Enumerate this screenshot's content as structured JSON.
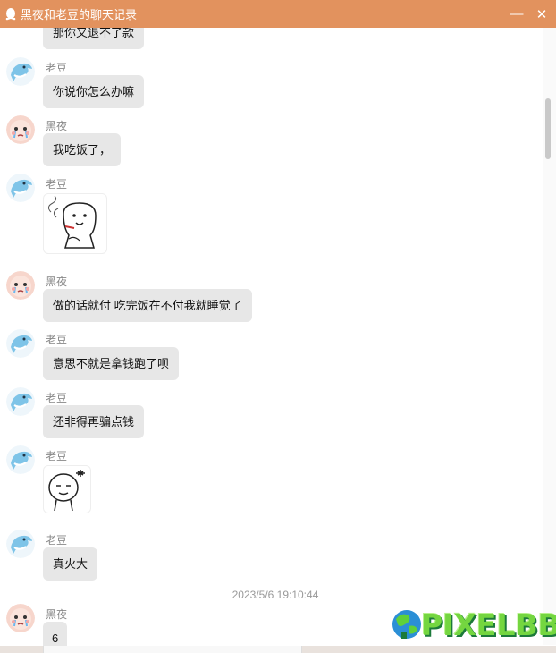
{
  "window": {
    "title": "黑夜和老豆的聊天记录",
    "minimize_glyph": "—",
    "close_glyph": "✕",
    "titlebar_color": "#e2925e"
  },
  "people": {
    "laodou": "老豆",
    "heiye": "黑夜"
  },
  "messages": [
    {
      "text": "那你又退不了款"
    },
    {
      "sender": "老豆",
      "text": "你说你怎么办嘛"
    },
    {
      "sender": "黑夜",
      "text": "我吃饭了，"
    },
    {
      "sender": "老豆",
      "sticker": "smoking-bear-sticker"
    },
    {
      "sender": "黑夜",
      "text": "做的话就付 吃完饭在不付我就睡觉了"
    },
    {
      "sender": "老豆",
      "text": "意思不就是拿钱跑了呗"
    },
    {
      "sender": "老豆",
      "text": "还非得再骗点钱"
    },
    {
      "sender": "老豆",
      "sticker": "angry-face-sticker"
    },
    {
      "sender": "老豆",
      "text": "真火大"
    },
    {
      "sender": "黑夜",
      "text": "6"
    }
  ],
  "timestamp": "2023/5/6 19:10:44",
  "watermark": "PIXELBBS",
  "icons": {
    "app": "qq-penguin-icon",
    "avatar_laodou": "dolphin-avatar-icon",
    "avatar_heiye": "crying-face-avatar-icon"
  }
}
